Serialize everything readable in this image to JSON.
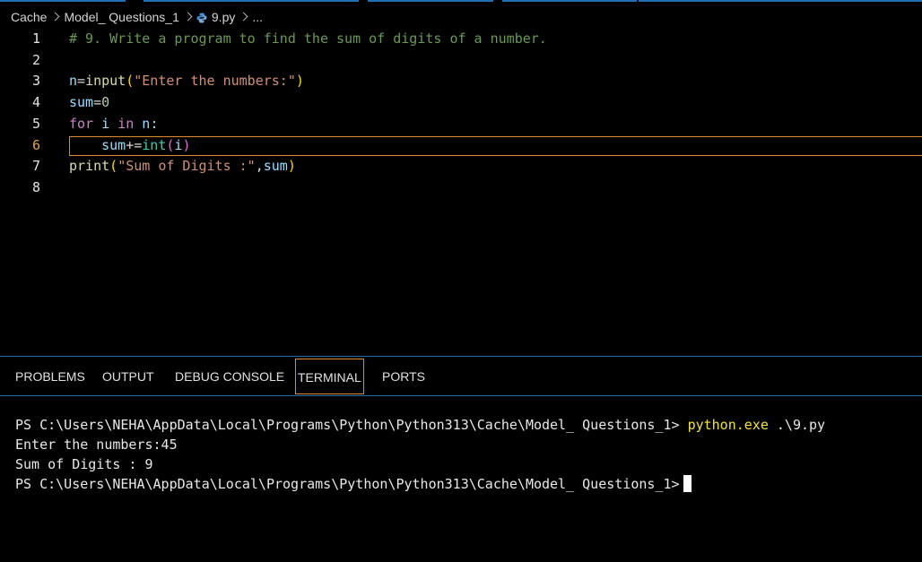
{
  "breadcrumb": {
    "items": [
      "Cache",
      "Model_ Questions_1",
      "9.py",
      "..."
    ]
  },
  "editor": {
    "current_line": 6,
    "lines": [
      {
        "num": "1"
      },
      {
        "num": "2"
      },
      {
        "num": "3"
      },
      {
        "num": "4"
      },
      {
        "num": "5"
      },
      {
        "num": "6"
      },
      {
        "num": "7"
      },
      {
        "num": "8"
      }
    ],
    "code": {
      "l1_comment": "# 9. Write a program to find the sum of digits of a number.",
      "l3_var": "n",
      "l3_eq": "=",
      "l3_fn": "input",
      "l3_open": "(",
      "l3_str": "\"Enter the numbers:\"",
      "l3_close": ")",
      "l4_var": "sum",
      "l4_eq": "=",
      "l4_num": "0",
      "l5_kw_for": "for",
      "l5_var_i": "i",
      "l5_kw_in": "in",
      "l5_var_n": "n",
      "l5_colon": ":",
      "l6_indent": "    ",
      "l6_var": "sum",
      "l6_op": "+=",
      "l6_type": "int",
      "l6_open": "(",
      "l6_arg": "i",
      "l6_close": ")",
      "l7_fn": "print",
      "l7_open": "(",
      "l7_str": "\"Sum of Digits :\"",
      "l7_comma": ",",
      "l7_var": "sum",
      "l7_close": ")"
    }
  },
  "panel": {
    "tabs": [
      "PROBLEMS",
      "OUTPUT",
      "DEBUG CONSOLE",
      "TERMINAL",
      "PORTS"
    ],
    "active_tab": "TERMINAL"
  },
  "terminal": {
    "prompt1": "PS C:\\Users\\NEHA\\AppData\\Local\\Programs\\Python\\Python313\\Cache\\Model_ Questions_1> ",
    "command": "python.exe",
    "command_arg": " .\\9.py",
    "output1": "Enter the numbers:45",
    "output2": "Sum of Digits : 9",
    "prompt2": "PS C:\\Users\\NEHA\\AppData\\Local\\Programs\\Python\\Python313\\Cache\\Model_ Questions_1>"
  },
  "colors": {
    "accent": "#1f6fb4",
    "active_border": "#e08b2c",
    "command": "#f1e43f"
  }
}
